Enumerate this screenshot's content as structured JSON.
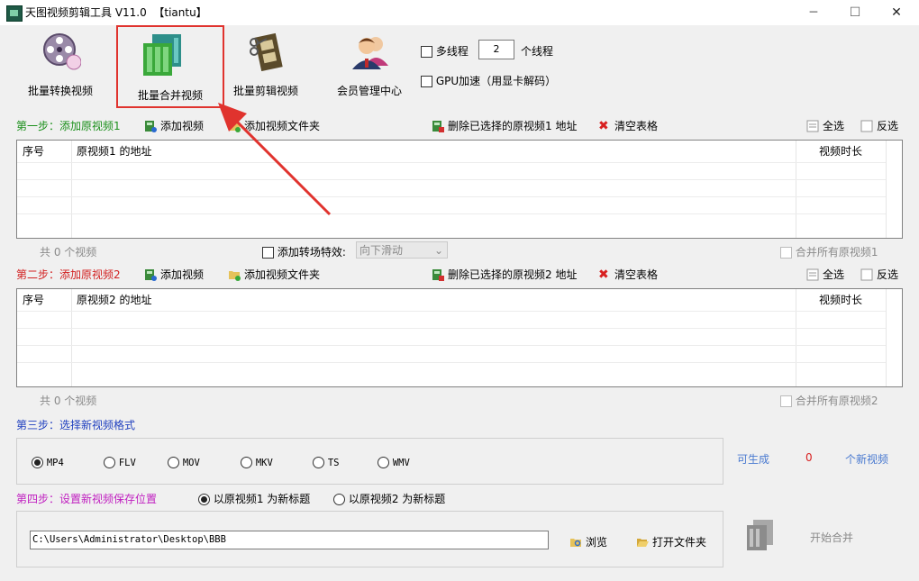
{
  "window": {
    "title": "天图视频剪辑工具 V11.0  【tiantu】",
    "minimize": "─",
    "maximize": "☐",
    "close": "✕"
  },
  "toolbar": {
    "batch_convert": "批量转换视频",
    "batch_merge": "批量合并视频",
    "batch_edit": "批量剪辑视频",
    "member_center": "会员管理中心",
    "multithread_label": "多线程",
    "thread_count": "2",
    "thread_unit": "个线程",
    "gpu_label": "GPU加速（用显卡解码）"
  },
  "step1": {
    "title": "第一步：添加原视频1",
    "add_video": "添加视频",
    "add_folder": "添加视频文件夹",
    "delete_selected": "删除已选择的原视频1 地址",
    "clear_table": "清空表格",
    "select_all": "全选",
    "invert": "反选",
    "col_index": "序号",
    "col_path": "原视频1 的地址",
    "col_duration": "视频时长",
    "count_text": "共 0 个视频",
    "transition_label": "添加转场特效:",
    "transition_value": "向下滑动",
    "merge_all": "合并所有原视频1"
  },
  "step2": {
    "title": "第二步：添加原视频2",
    "add_video": "添加视频",
    "add_folder": "添加视频文件夹",
    "delete_selected": "删除已选择的原视频2 地址",
    "clear_table": "清空表格",
    "select_all": "全选",
    "invert": "反选",
    "col_index": "序号",
    "col_path": "原视频2 的地址",
    "col_duration": "视频时长",
    "count_text": "共 0 个视频",
    "merge_all": "合并所有原视频2"
  },
  "step3": {
    "title": "第三步：选择新视频格式",
    "formats": [
      "MP4",
      "FLV",
      "MOV",
      "MKV",
      "TS",
      "WMV"
    ],
    "selected": "MP4",
    "can_generate": "可生成",
    "count": "0",
    "unit": "个新视频"
  },
  "step4": {
    "title": "第四步：设置新视频保存位置",
    "option1": "以原视频1 为新标题",
    "option2": "以原视频2 为新标题",
    "path": "C:\\Users\\Administrator\\Desktop\\BBB",
    "browse": "浏览",
    "open_folder": "打开文件夹",
    "start": "开始合并"
  },
  "colors": {
    "highlight": "#e0332e",
    "arrow": "#e0332e",
    "step1": "#1a8f1a",
    "step2": "#d22020",
    "step3": "#1f3fbf",
    "step4": "#c020c0"
  }
}
